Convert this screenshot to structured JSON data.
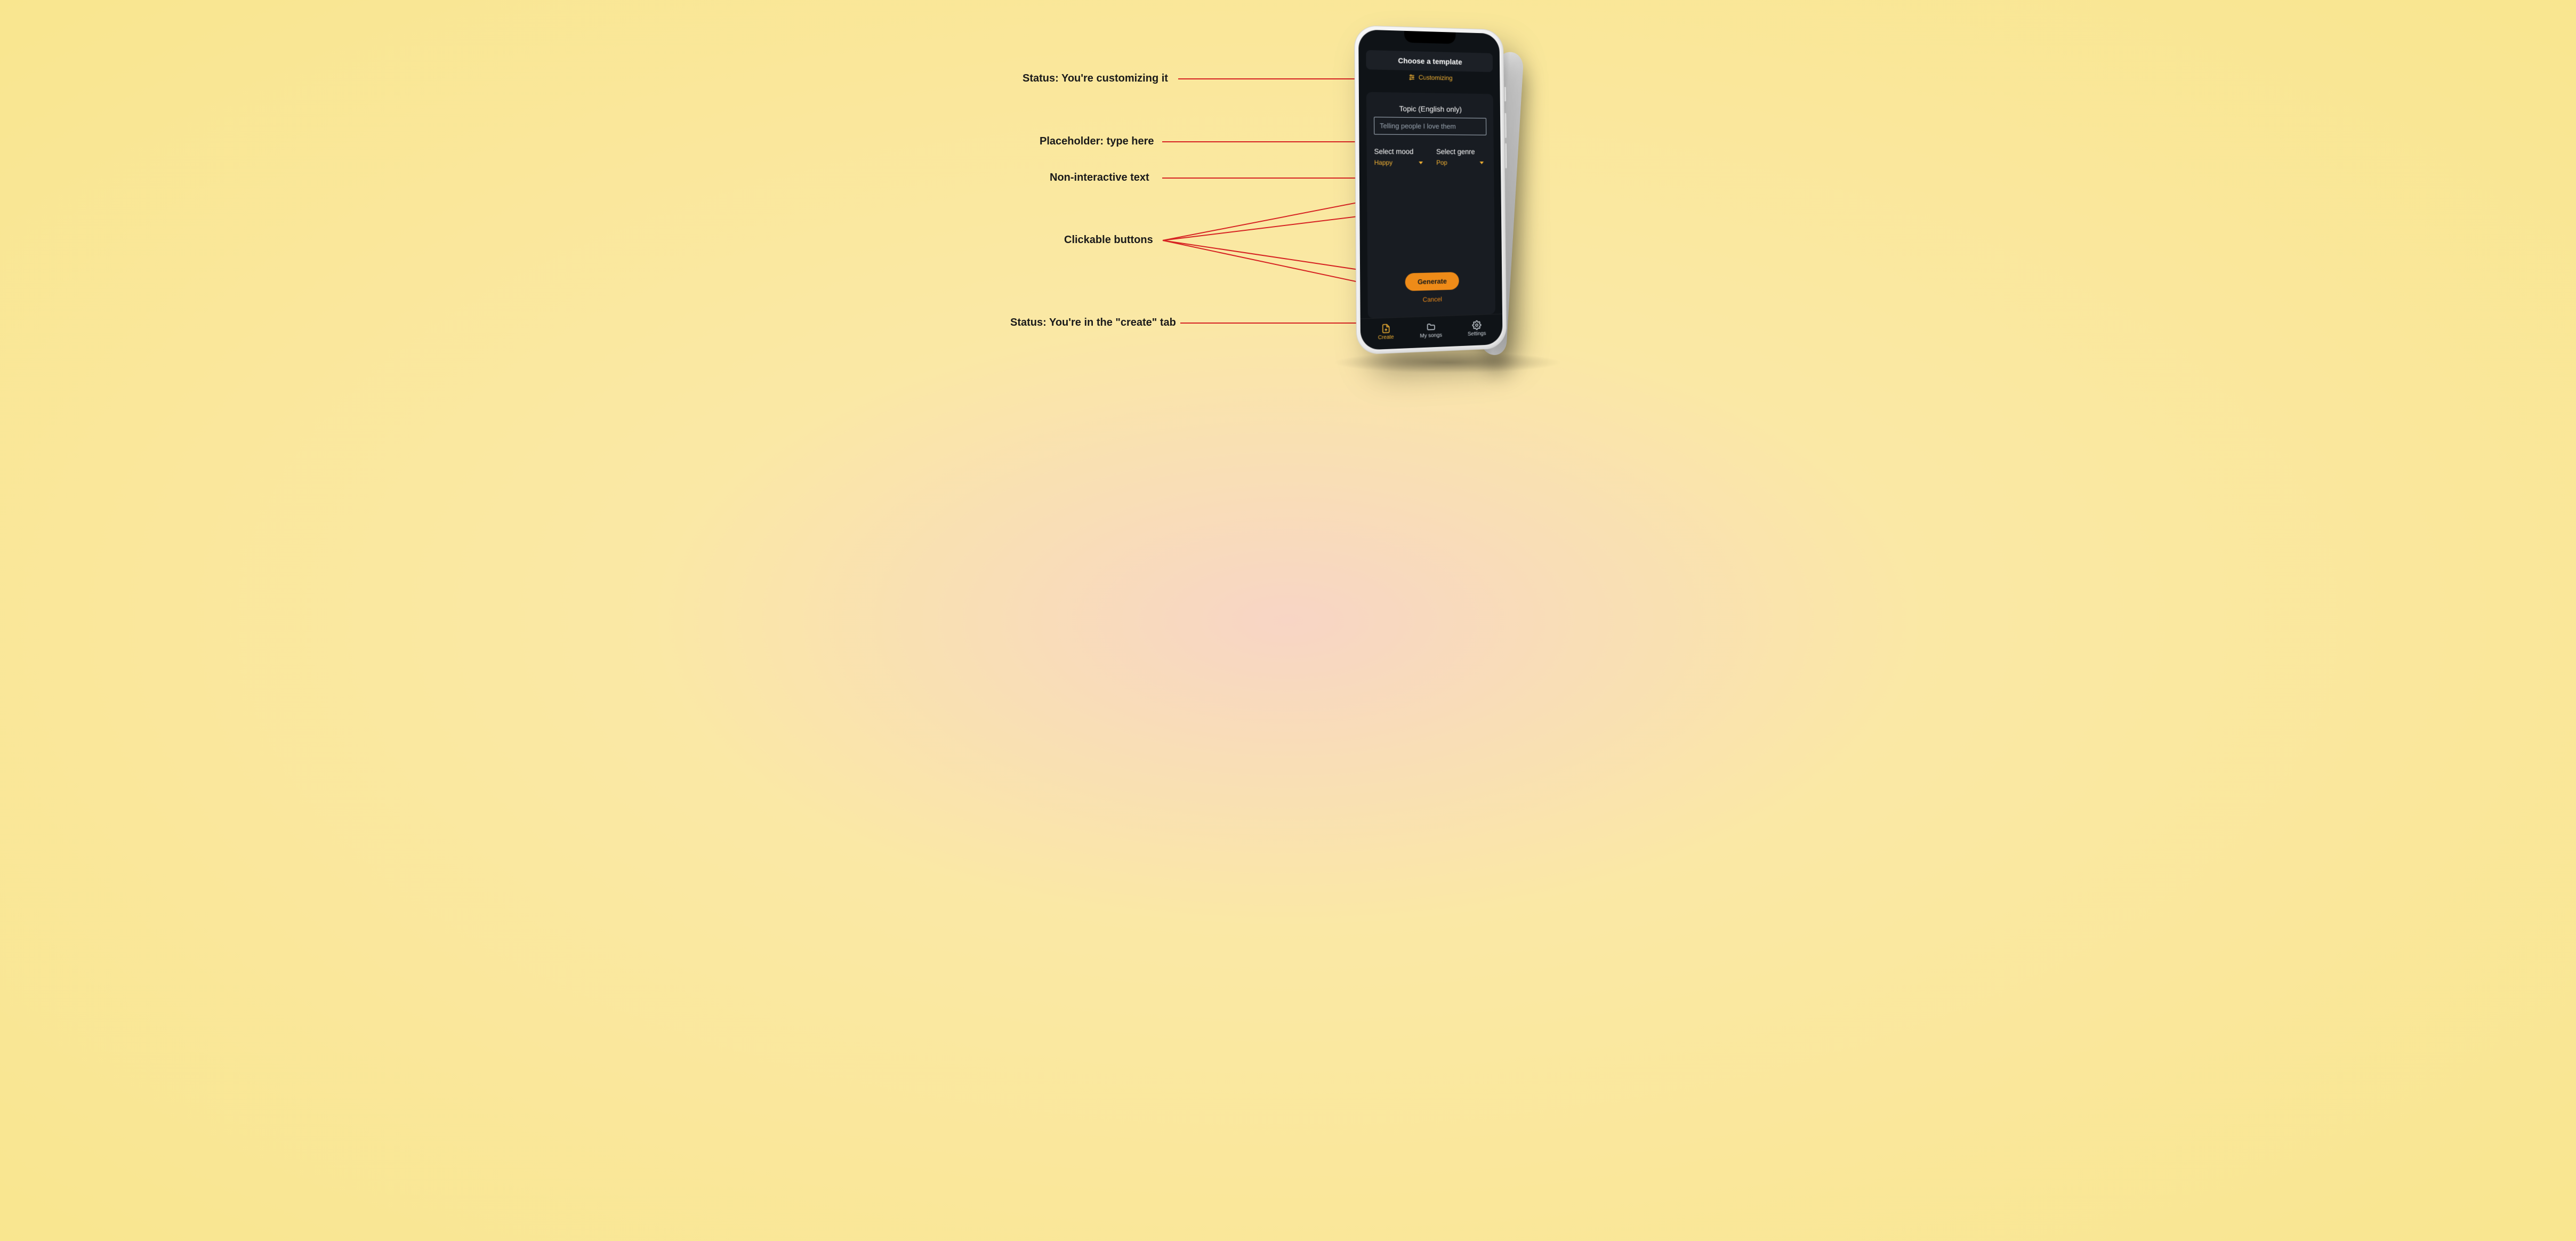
{
  "annotations": {
    "status_customizing": "Status: You're customizing it",
    "placeholder": "Placeholder: type here",
    "noninteractive": "Non-interactive text",
    "clickable": "Clickable buttons",
    "status_create_tab": "Status: You're in the \"create\" tab"
  },
  "header": {
    "template_label": "Choose a template",
    "status_label": "Customizing"
  },
  "topic": {
    "label": "Topic (English only)",
    "placeholder": "Telling people I love them"
  },
  "selects": {
    "mood": {
      "label": "Select mood",
      "value": "Happy"
    },
    "genre": {
      "label": "Select genre",
      "value": "Pop"
    }
  },
  "actions": {
    "generate": "Generate",
    "cancel": "Cancel"
  },
  "tabs": {
    "create": "Create",
    "mysongs": "My songs",
    "settings": "Settings"
  },
  "colors": {
    "accent": "#f3b233",
    "primary_btn": "#ee8b18",
    "annotation_line": "#d62222"
  }
}
